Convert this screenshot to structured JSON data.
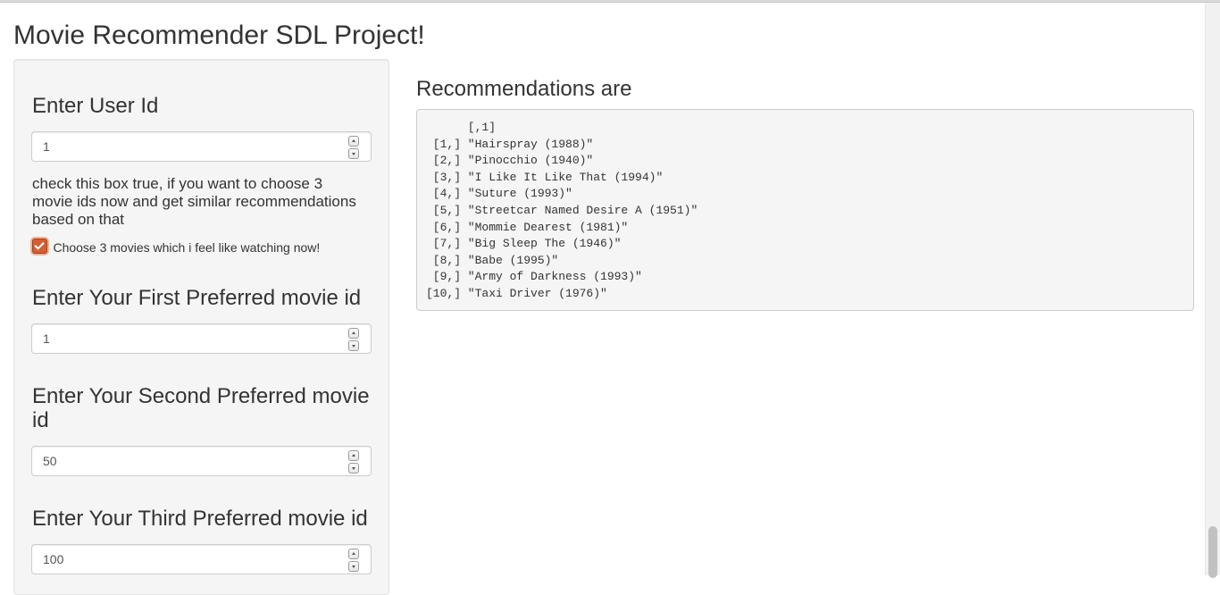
{
  "app": {
    "title": "Movie Recommender SDL Project!"
  },
  "sidebar": {
    "user_id_label": "Enter User Id",
    "user_id_value": "1",
    "help_text": "check this box true, if you want to choose 3 movie ids now and get similar recommendations based on that",
    "checkbox": {
      "label": "Choose 3 movies which i feel like watching now!",
      "checked": true
    },
    "first_label": "Enter Your First Preferred movie id",
    "first_value": "1",
    "second_label": "Enter Your Second Preferred movie id",
    "second_value": "50",
    "third_label": "Enter Your Third Preferred movie id",
    "third_value": "100"
  },
  "main": {
    "heading": "Recommendations are",
    "output_header": "      [,1]",
    "output_rows": [
      " [1,] \"Hairspray (1988)\"",
      " [2,] \"Pinocchio (1940)\"",
      " [3,] \"I Like It Like That (1994)\"",
      " [4,] \"Suture (1993)\"",
      " [5,] \"Streetcar Named Desire A (1951)\"",
      " [6,] \"Mommie Dearest (1981)\"",
      " [7,] \"Big Sleep The (1946)\"",
      " [8,] \"Babe (1995)\"",
      " [9,] \"Army of Darkness (1993)\"",
      "[10,] \"Taxi Driver (1976)\""
    ]
  },
  "icons": {
    "spinner_up": "chevron-up-icon",
    "spinner_down": "chevron-down-icon",
    "checkmark": "checkmark-icon"
  },
  "colors": {
    "checkbox_accent": "#d35f35",
    "panel_bg": "#f5f5f5",
    "text": "#333333"
  }
}
